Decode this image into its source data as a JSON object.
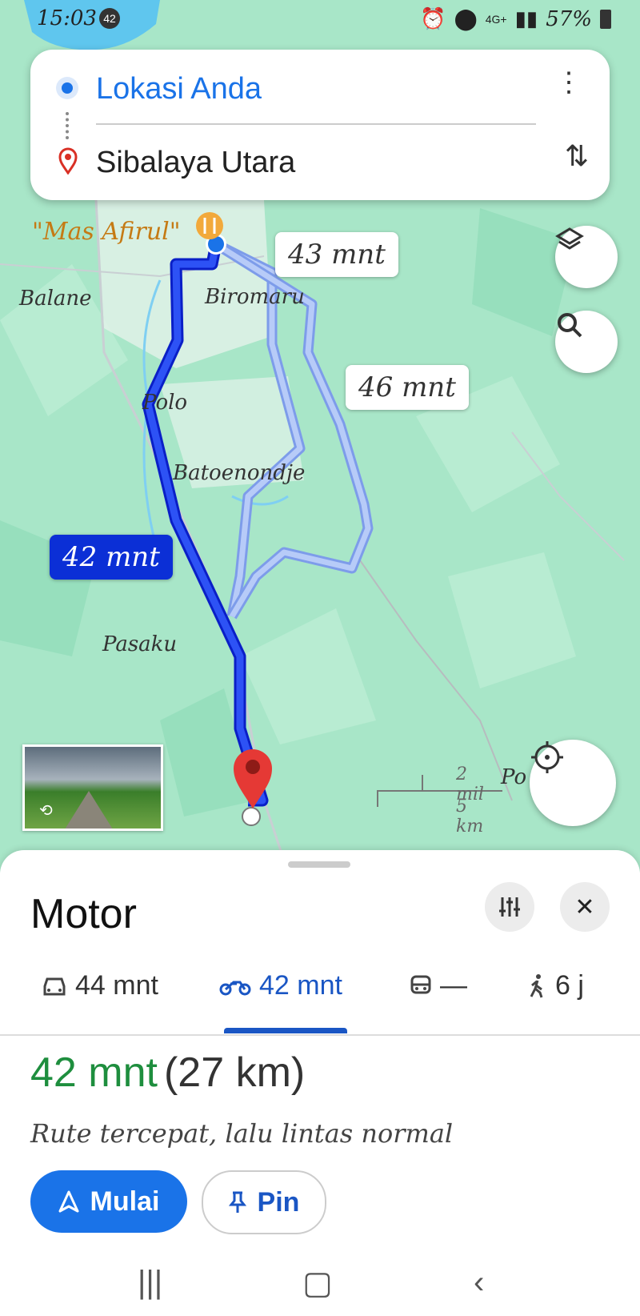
{
  "status_bar": {
    "time": "15:03",
    "notification_badge": "42",
    "network": "4G+",
    "battery": "57%"
  },
  "search": {
    "origin": "Lokasi Anda",
    "destination": "Sibalaya Utara"
  },
  "map": {
    "restaurant_label": "\"Mas Afirul\"",
    "place_labels": [
      "Balane",
      "Biromaru",
      "Polo",
      "Batoenondje",
      "Pasaku"
    ],
    "route_times": {
      "selected": "42 mnt",
      "alt1": "43 mnt",
      "alt2": "46 mnt"
    },
    "scale": {
      "miles": "2 mil",
      "km": "5 km"
    },
    "edge_label": "Po",
    "colors": {
      "map_bg": "#a8e6c8",
      "selected_route": "#1a3cf0",
      "alt_route": "#a9c4f5",
      "water": "#5fc6ee"
    }
  },
  "panel": {
    "title": "Motor",
    "modes": [
      {
        "icon": "car-icon",
        "label": "44 mnt"
      },
      {
        "icon": "motorcycle-icon",
        "label": "42 mnt"
      },
      {
        "icon": "transit-icon",
        "label": "—"
      },
      {
        "icon": "walk-icon",
        "label": "6 j"
      }
    ],
    "duration": "42 mnt",
    "distance": "(27 km)",
    "description": "Rute tercepat, lalu lintas normal",
    "start_label": "Mulai",
    "pin_label": "Pin"
  }
}
